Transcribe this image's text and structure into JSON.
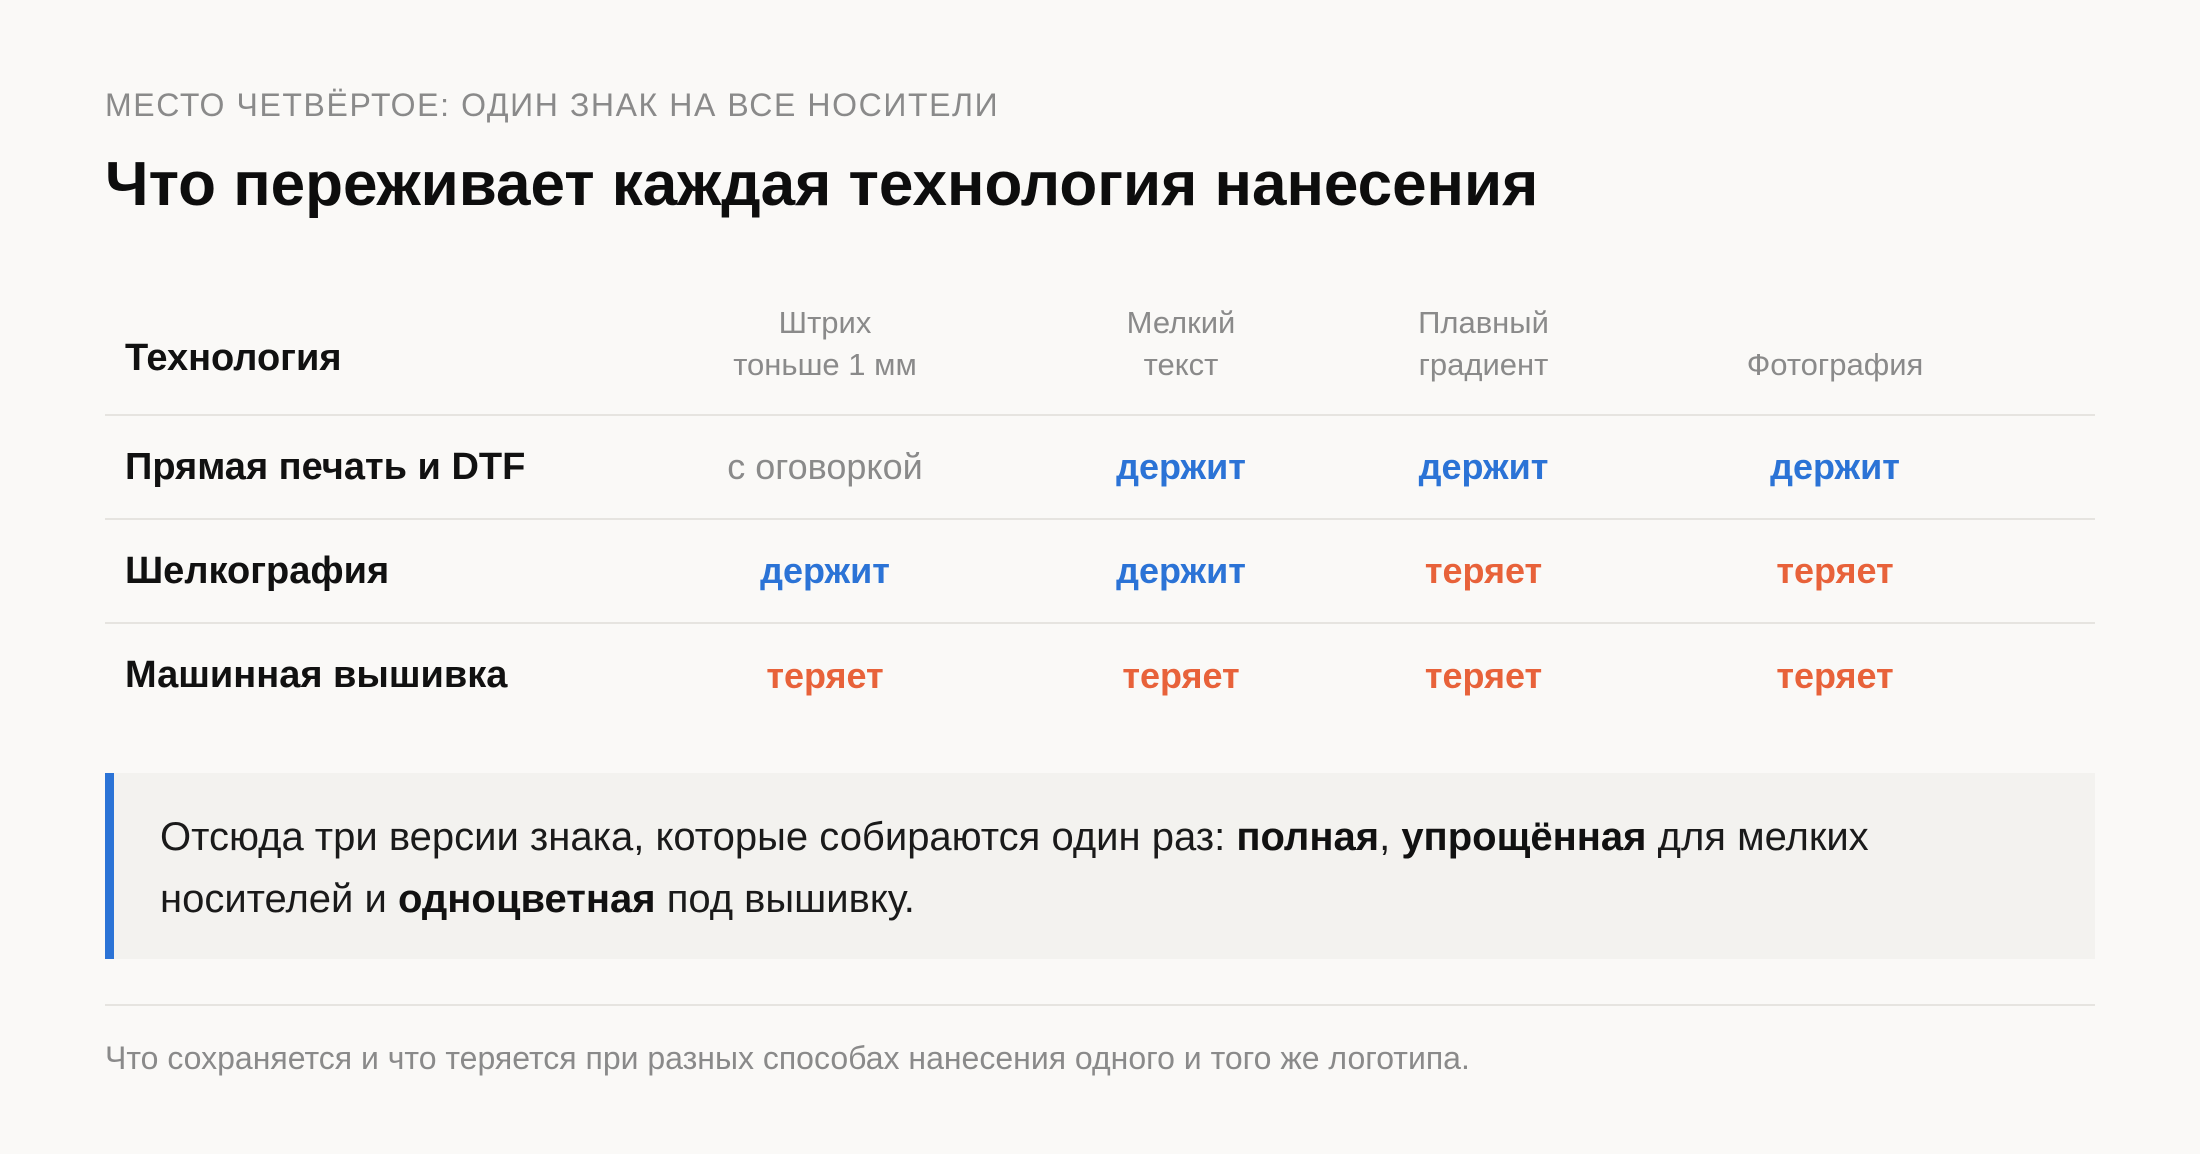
{
  "kicker": "МЕСТО ЧЕТВЁРТОЕ: ОДИН ЗНАК НА ВСЕ НОСИТЕЛИ",
  "title": "Что переживает каждая технология нанесения",
  "table": {
    "first_header": "Технология",
    "columns": [
      {
        "line1": "Штрих",
        "line2": "тоньше 1 мм"
      },
      {
        "line1": "Мелкий",
        "line2": "текст"
      },
      {
        "line1": "Плавный",
        "line2": "градиент"
      },
      {
        "line1": "",
        "line2": "Фотография"
      }
    ],
    "rows": [
      {
        "label": "Прямая печать и DTF",
        "cells": [
          "с оговоркой",
          "держит",
          "держит",
          "держит"
        ]
      },
      {
        "label": "Шелкография",
        "cells": [
          "держит",
          "держит",
          "теряет",
          "теряет"
        ]
      },
      {
        "label": "Машинная вышивка",
        "cells": [
          "теряет",
          "теряет",
          "теряет",
          "теряет"
        ]
      }
    ],
    "status_colors": {
      "держит": "#2b73d6",
      "теряет": "#e8623a",
      "с оговоркой": "#8a8a8a"
    }
  },
  "callout": {
    "text1": "Отсюда три версии знака, которые собираются один раз: ",
    "bold1": "полная",
    "sep1": ", ",
    "bold2": "упрощённая",
    "text2": " для мелких носителей и ",
    "bold3": "одноцветная",
    "text3": " под вышивку.",
    "accent_color": "#2b73d6"
  },
  "caption": "Что сохраняется и что теряется при разных способах нанесения одного и того же логотипа."
}
